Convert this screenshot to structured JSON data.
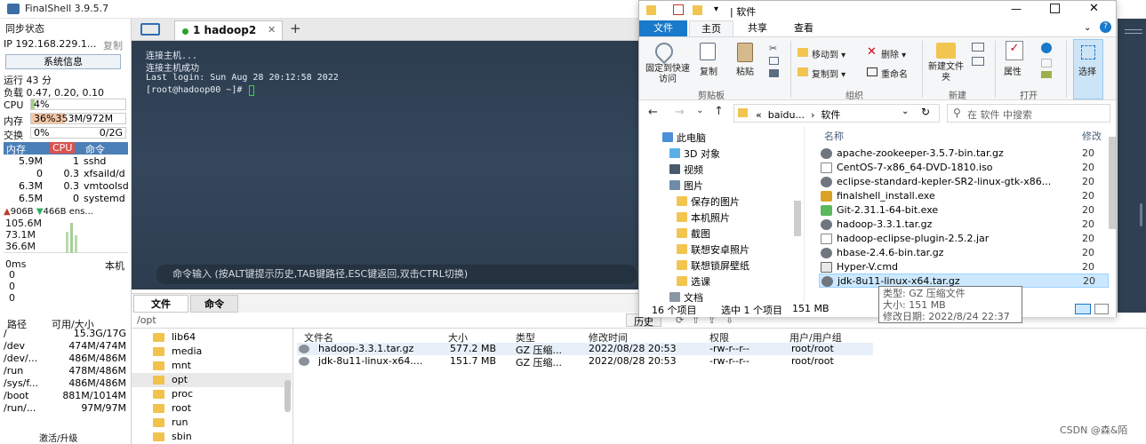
{
  "app": {
    "title": "FinalShell 3.9.5.7"
  },
  "sidebar": {
    "sync_status": "同步状态",
    "ip": "IP 192.168.229.1...",
    "copy": "复制",
    "sysinfo_btn": "系统信息",
    "uptime": "运行 43 分",
    "load": "负载 0.47, 0.20, 0.10",
    "cpu_label": "CPU",
    "cpu_value": "4%",
    "cpu_fraction": 0.04,
    "mem_label": "内存",
    "mem_value": "36%353M/972M",
    "mem_fraction": 0.36,
    "swap_label": "交换",
    "swap_value": "0%",
    "swap_total": "0/2G",
    "proc_headers": [
      "内存",
      "CPU",
      "命令"
    ],
    "processes": [
      {
        "mem": "5.9M",
        "cpu": "1",
        "cmd": "sshd"
      },
      {
        "mem": "0",
        "cpu": "0.3",
        "cmd": "xfsaild/d"
      },
      {
        "mem": "6.3M",
        "cpu": "0.3",
        "cmd": "vmtoolsd"
      },
      {
        "mem": "6.5M",
        "cpu": "0",
        "cmd": "systemd"
      }
    ],
    "net_up": "906B",
    "net_down": "466B",
    "net_iface": "ens...",
    "net_scale": [
      "105.6M",
      "73.1M",
      "36.6M"
    ],
    "latency_label": "0ms",
    "latency_host": "本机",
    "latency_values": [
      "0",
      "0",
      "0"
    ],
    "disk_headers": [
      "路径",
      "可用/大小"
    ],
    "disks": [
      {
        "path": "/",
        "size": "15.3G/17G"
      },
      {
        "path": "/dev",
        "size": "474M/474M"
      },
      {
        "path": "/dev/...",
        "size": "486M/486M"
      },
      {
        "path": "/run",
        "size": "478M/486M"
      },
      {
        "path": "/sys/f...",
        "size": "486M/486M"
      },
      {
        "path": "/boot",
        "size": "881M/1014M"
      },
      {
        "path": "/run/...",
        "size": "97M/97M"
      }
    ],
    "activate": "激活/升级"
  },
  "terminal": {
    "tab_label": "1 hadoop2",
    "lines": [
      "连接主机...",
      "连接主机成功",
      "Last login: Sun Aug 28 20:12:58 2022",
      "[root@hadoop00 ~]# "
    ],
    "command_hint": "命令输入 (按ALT键提示历史,TAB键路径,ESC键返回,双击CTRL切换)"
  },
  "file_manager": {
    "tabs": [
      "文件",
      "命令"
    ],
    "path": "/opt",
    "history_btn": "历史",
    "tree": [
      "lib64",
      "media",
      "mnt",
      "opt",
      "proc",
      "root",
      "run",
      "sbin"
    ],
    "columns": [
      "文件名",
      "大小",
      "类型",
      "修改时间",
      "权限",
      "用户/用户组"
    ],
    "files": [
      {
        "name": "hadoop-3.3.1.tar.gz",
        "size": "577.2 MB",
        "type": "GZ 压缩...",
        "mtime": "2022/08/28 20:53",
        "perm": "-rw-r--r--",
        "owner": "root/root"
      },
      {
        "name": "jdk-8u11-linux-x64....",
        "size": "151.7 MB",
        "type": "GZ 压缩...",
        "mtime": "2022/08/28 20:53",
        "perm": "-rw-r--r--",
        "owner": "root/root"
      }
    ]
  },
  "explorer": {
    "title": "软件",
    "tabs": [
      "文件",
      "主页",
      "共享",
      "查看"
    ],
    "ribbon": {
      "pin": "固定到快速访问",
      "copy": "复制",
      "paste": "粘贴",
      "move_to": "移动到",
      "delete": "删除",
      "copy_to": "复制到",
      "rename": "重命名",
      "new_folder": "新建文件夹",
      "properties": "属性",
      "select": "选择",
      "group_clipboard": "剪贴板",
      "group_organize": "组织",
      "group_new": "新建",
      "group_open": "打开"
    },
    "address": [
      "«",
      "baidu...",
      "›",
      "软件"
    ],
    "search_placeholder": "在 软件 中搜索",
    "nav": [
      {
        "label": "此电脑",
        "icon": "pc-icon"
      },
      {
        "label": "3D 对象",
        "icon": "3d-icon"
      },
      {
        "label": "视频",
        "icon": "video-icon"
      },
      {
        "label": "图片",
        "icon": "pictures-icon"
      },
      {
        "label": "保存的图片",
        "icon": "folder-icon"
      },
      {
        "label": "本机照片",
        "icon": "folder-icon"
      },
      {
        "label": "截图",
        "icon": "folder-icon"
      },
      {
        "label": "联想安卓照片",
        "icon": "folder-icon"
      },
      {
        "label": "联想锁屏壁纸",
        "icon": "folder-icon"
      },
      {
        "label": "选课",
        "icon": "folder-icon"
      },
      {
        "label": "文档",
        "icon": "documents-icon"
      }
    ],
    "col_name": "名称",
    "col_date": "修改",
    "files": [
      {
        "name": "apache-zookeeper-3.5.7-bin.tar.gz",
        "date": "20"
      },
      {
        "name": "CentOS-7-x86_64-DVD-1810.iso",
        "date": "20"
      },
      {
        "name": "eclipse-standard-kepler-SR2-linux-gtk-x86...",
        "date": "20"
      },
      {
        "name": "finalshell_install.exe",
        "date": "20"
      },
      {
        "name": "Git-2.31.1-64-bit.exe",
        "date": "20"
      },
      {
        "name": "hadoop-3.3.1.tar.gz",
        "date": "20"
      },
      {
        "name": "hadoop-eclipse-plugin-2.5.2.jar",
        "date": "20"
      },
      {
        "name": "hbase-2.4.6-bin.tar.gz",
        "date": "20"
      },
      {
        "name": "Hyper-V.cmd",
        "date": "20"
      },
      {
        "name": "jdk-8u11-linux-x64.tar.gz",
        "date": "20"
      }
    ],
    "status_count": "16 个项目",
    "status_selected": "选中 1 个项目",
    "status_size": "151 MB",
    "tooltip": [
      "类型: GZ 压缩文件",
      "大小: 151 MB",
      "修改日期: 2022/8/24 22:37"
    ]
  },
  "watermark": "CSDN @森&陌"
}
